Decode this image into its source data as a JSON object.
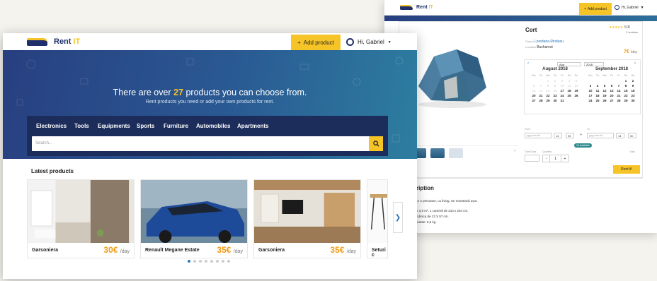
{
  "back": {
    "brand": {
      "name": "Rent",
      "suffix": "IT"
    },
    "add_label": "Add product",
    "user_label": "Hi, Gabriel",
    "product": {
      "title": "Cort",
      "rating": "5.00",
      "reviews": "2 reviews",
      "owner_label": "Owner",
      "owner": "Loredana Rindasu",
      "location_label": "Location",
      "location": "Bucharest",
      "price": "7€",
      "per": "/day"
    },
    "calendar": {
      "month_select": "Aug",
      "year_select": "2018",
      "weekdays": [
        "Mo",
        "Tu",
        "We",
        "Th",
        "Fr",
        "Sa",
        "Su"
      ],
      "left": {
        "title": "August 2018",
        "days": [
          "",
          "",
          "1",
          "2",
          "3",
          "4",
          "5",
          "6",
          "7",
          "8",
          "9",
          "10",
          "11",
          "12",
          "13",
          "14",
          "15",
          "16",
          "17",
          "18",
          "19",
          "20",
          "21",
          "22",
          "23",
          "24",
          "25",
          "26",
          "27",
          "28",
          "29",
          "30",
          "31"
        ]
      },
      "right": {
        "title": "September 2018",
        "days": [
          "",
          "",
          "",
          "",
          "",
          "1",
          "2",
          "3",
          "4",
          "5",
          "6",
          "7",
          "8",
          "9",
          "10",
          "11",
          "12",
          "13",
          "14",
          "15",
          "16",
          "17",
          "18",
          "19",
          "20",
          "21",
          "22",
          "23",
          "24",
          "25",
          "26",
          "27",
          "28",
          "29",
          "30"
        ]
      }
    },
    "booking": {
      "from_label": "From",
      "to_label": "To",
      "date_placeholder": "yyyy-mm-dd",
      "from_hour": "14",
      "from_min": "00",
      "to_hour": "14",
      "to_min": "00",
      "available": "15 available",
      "total_days_label": "Total Days",
      "quantity_label": "Quantity",
      "quantity": "1",
      "total_label": "Total",
      "rent_label": "Rent it!"
    },
    "description": {
      "title": "ription",
      "lines": [
        "ru 4 persoane, cu living. Se montează ușor.",
        "e 3,9 m², 1 cameră de 210 x 240 cm.",
        "ndinica de 13 X 57 cm.",
        "eutate: 6,5 kg."
      ]
    }
  },
  "front": {
    "brand": {
      "name": "Rent",
      "suffix": "IT"
    },
    "add_label": "Add product",
    "user_label": "Hi, Gabriel",
    "hero": {
      "prefix": "There are over ",
      "count": "27",
      "suffix": " products you can choose from.",
      "subtitle": "Rent products you need or add your own products for rent."
    },
    "categories": [
      "Electronics",
      "Tools",
      "Equipments",
      "Sports",
      "Furniture",
      "Automobiles",
      "Apartments"
    ],
    "search_placeholder": "Search...",
    "latest_title": "Latest products",
    "products": [
      {
        "name": "Garsoniera",
        "price": "30€",
        "per": "/day"
      },
      {
        "name": "Renault Megane Estate",
        "price": "35€",
        "per": "/day"
      },
      {
        "name": "Garsoniera",
        "price": "35€",
        "per": "/day"
      },
      {
        "name": "Seturi c",
        "price": "",
        "per": ""
      }
    ],
    "carousel_dots": 8
  },
  "colors": {
    "brand_navy": "#1f2f6b",
    "accent_yellow": "#f6c427",
    "price_orange": "#f39b15",
    "link_blue": "#2b7bc0"
  }
}
